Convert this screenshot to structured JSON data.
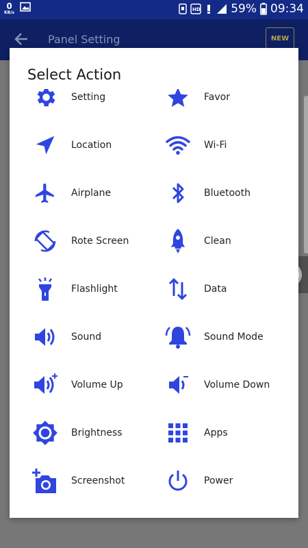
{
  "status_bar": {
    "net_speed": "0",
    "net_unit": "KB/s",
    "battery": "59%",
    "time": "09:34"
  },
  "app_bar": {
    "title": "Panel Setting",
    "badge": "NEW"
  },
  "dialog": {
    "title": "Select Action",
    "items": [
      {
        "label": "Setting",
        "icon": "gear-icon"
      },
      {
        "label": "Favor",
        "icon": "star-icon"
      },
      {
        "label": "Location",
        "icon": "navigation-arrow-icon"
      },
      {
        "label": "Wi-Fi",
        "icon": "wifi-icon"
      },
      {
        "label": "Airplane",
        "icon": "airplane-icon"
      },
      {
        "label": "Bluetooth",
        "icon": "bluetooth-icon"
      },
      {
        "label": "Rote Screen",
        "icon": "screen-rotation-icon"
      },
      {
        "label": "Clean",
        "icon": "rocket-icon"
      },
      {
        "label": "Flashlight",
        "icon": "flashlight-icon"
      },
      {
        "label": "Data",
        "icon": "data-transfer-icon"
      },
      {
        "label": "Sound",
        "icon": "speaker-icon"
      },
      {
        "label": "Sound Mode",
        "icon": "bell-icon"
      },
      {
        "label": "Volume Up",
        "icon": "volume-up-icon"
      },
      {
        "label": "Volume Down",
        "icon": "volume-down-icon"
      },
      {
        "label": "Brightness",
        "icon": "brightness-icon"
      },
      {
        "label": "Apps",
        "icon": "apps-grid-icon"
      },
      {
        "label": "Screenshot",
        "icon": "add-photo-icon"
      },
      {
        "label": "Power",
        "icon": "power-icon"
      }
    ]
  },
  "colors": {
    "accent": "#2f45e0",
    "status_bar": "#132a86",
    "overlay": "#777777"
  }
}
